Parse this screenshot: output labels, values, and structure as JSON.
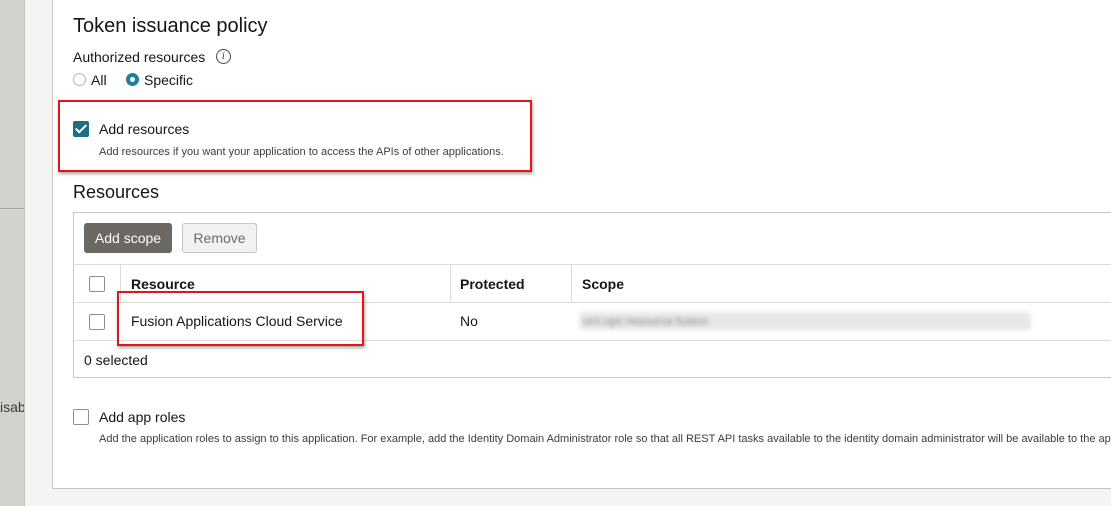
{
  "left_panel": {
    "clipped_text": "isab"
  },
  "token_policy": {
    "title": "Token issuance policy",
    "authorized_resources_label": "Authorized resources",
    "info_icon_glyph": "i",
    "radio_all": "All",
    "radio_specific": "Specific",
    "selected": "Specific"
  },
  "add_resources": {
    "label": "Add resources",
    "checked": true,
    "description": "Add resources if you want your application to access the APIs of other applications."
  },
  "resources": {
    "title": "Resources",
    "add_scope_label": "Add scope",
    "remove_label": "Remove",
    "columns": [
      "Resource",
      "Protected",
      "Scope"
    ],
    "rows": [
      {
        "resource": "Fusion Applications Cloud Service",
        "protected": "No",
        "scope": "urn:opc:resource:fusion"
      }
    ],
    "selected_count": "0 selected"
  },
  "add_app_roles": {
    "label": "Add app roles",
    "checked": false,
    "description": "Add the application roles to assign to this application. For example, add the Identity Domain Administrator role so that all REST API tasks available to the identity domain administrator will be available to the ap"
  },
  "colors": {
    "accent": "#227e9e",
    "highlight": "#e0161b",
    "primary_button": "#6b6762"
  }
}
